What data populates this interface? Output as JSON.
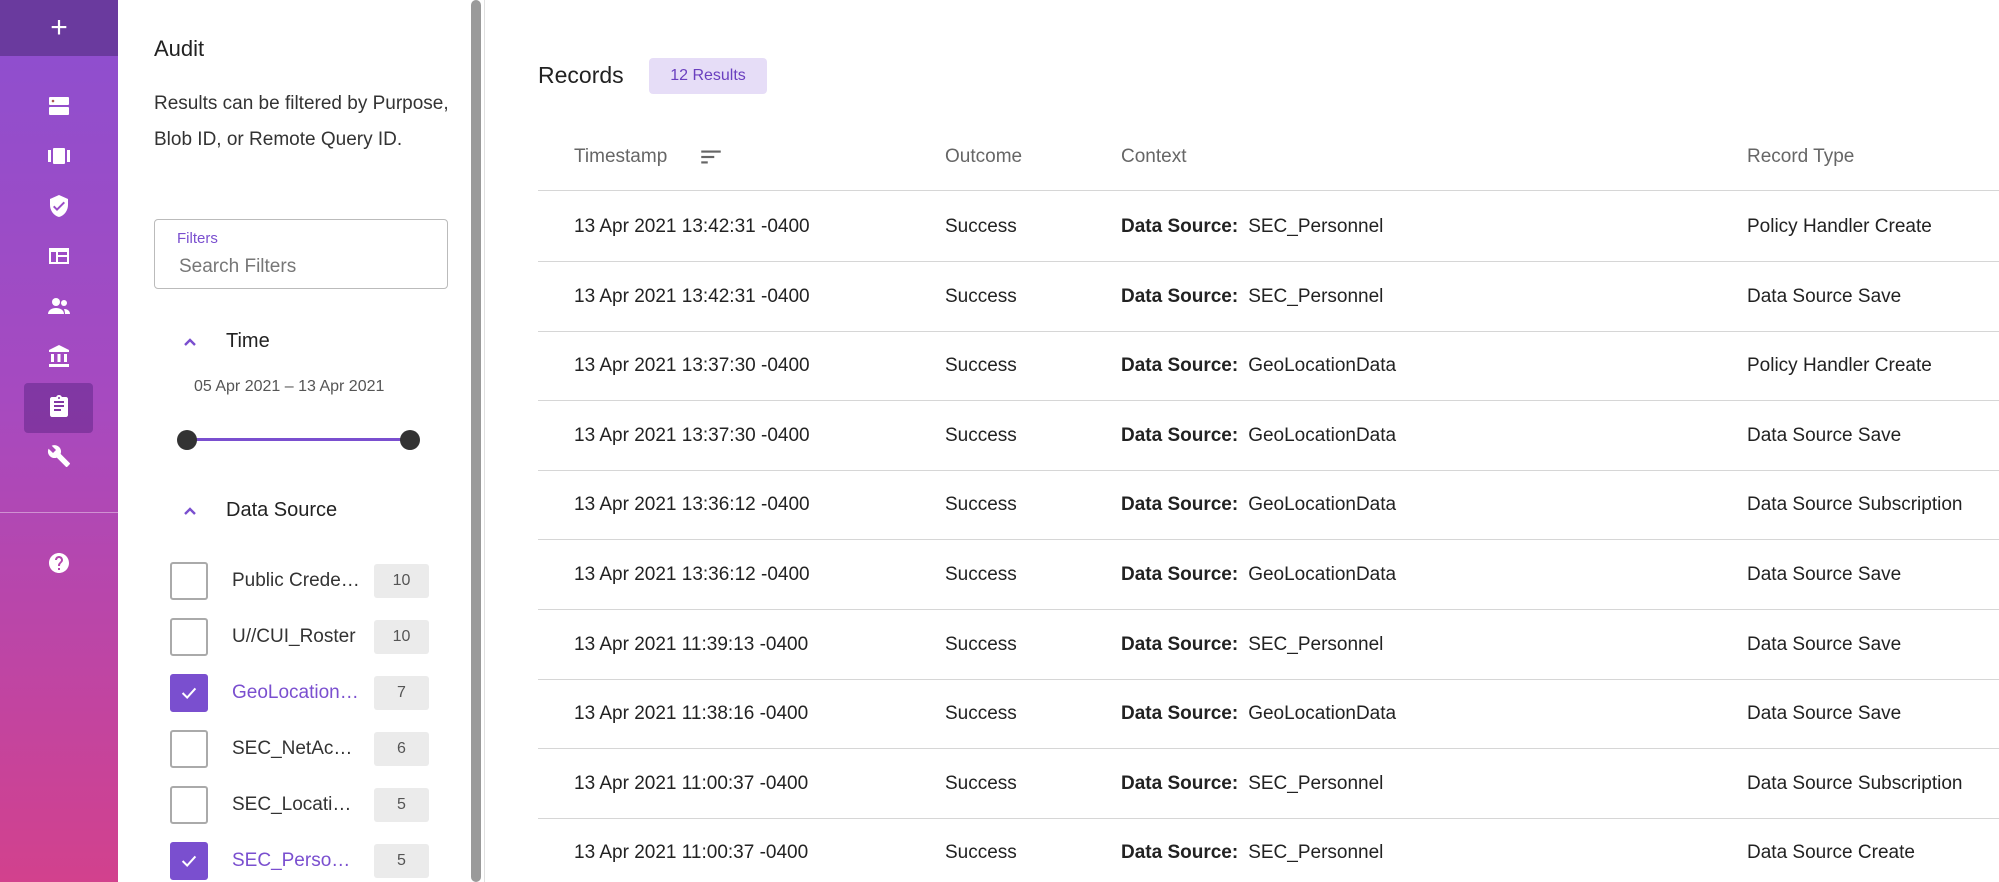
{
  "nav": {
    "add_label": "+",
    "items": [
      {
        "name": "servers-icon"
      },
      {
        "name": "cards-icon"
      },
      {
        "name": "shield-check-icon"
      },
      {
        "name": "table-icon"
      },
      {
        "name": "users-icon"
      },
      {
        "name": "bank-icon"
      },
      {
        "name": "clipboard-icon",
        "active": true
      },
      {
        "name": "wrench-icon"
      },
      {
        "name": "help-icon"
      }
    ]
  },
  "panel": {
    "title": "Audit",
    "description": "Results can be filtered by Purpose, Blob ID, or Remote Query ID.",
    "filters_label": "Filters",
    "search_placeholder": "Search Filters",
    "time_section": "Time",
    "time_range": "05 Apr 2021 – 13 Apr 2021",
    "data_source_section": "Data Source",
    "data_sources": [
      {
        "name": "Public Credentials",
        "count": "10",
        "checked": false
      },
      {
        "name": "U//CUI_Roster",
        "count": "10",
        "checked": false
      },
      {
        "name": "GeoLocationData",
        "count": "7",
        "checked": true
      },
      {
        "name": "SEC_NetAccess",
        "count": "6",
        "checked": false
      },
      {
        "name": "SEC_Locations",
        "count": "5",
        "checked": false
      },
      {
        "name": "SEC_Personnel",
        "count": "5",
        "checked": true
      }
    ]
  },
  "main": {
    "title": "Records",
    "results_badge": "12 Results",
    "columns": {
      "timestamp": "Timestamp",
      "outcome": "Outcome",
      "context": "Context",
      "record_type": "Record Type"
    },
    "context_prefix": "Data Source:",
    "rows": [
      {
        "timestamp": "13 Apr 2021 13:42:31 -0400",
        "outcome": "Success",
        "context": "SEC_Personnel",
        "record_type": "Policy Handler Create"
      },
      {
        "timestamp": "13 Apr 2021 13:42:31 -0400",
        "outcome": "Success",
        "context": "SEC_Personnel",
        "record_type": "Data Source Save"
      },
      {
        "timestamp": "13 Apr 2021 13:37:30 -0400",
        "outcome": "Success",
        "context": "GeoLocationData",
        "record_type": "Policy Handler Create"
      },
      {
        "timestamp": "13 Apr 2021 13:37:30 -0400",
        "outcome": "Success",
        "context": "GeoLocationData",
        "record_type": "Data Source Save"
      },
      {
        "timestamp": "13 Apr 2021 13:36:12 -0400",
        "outcome": "Success",
        "context": "GeoLocationData",
        "record_type": "Data Source Subscription"
      },
      {
        "timestamp": "13 Apr 2021 13:36:12 -0400",
        "outcome": "Success",
        "context": "GeoLocationData",
        "record_type": "Data Source Save"
      },
      {
        "timestamp": "13 Apr 2021 11:39:13 -0400",
        "outcome": "Success",
        "context": "SEC_Personnel",
        "record_type": "Data Source Save"
      },
      {
        "timestamp": "13 Apr 2021 11:38:16 -0400",
        "outcome": "Success",
        "context": "GeoLocationData",
        "record_type": "Data Source Save"
      },
      {
        "timestamp": "13 Apr 2021 11:00:37 -0400",
        "outcome": "Success",
        "context": "SEC_Personnel",
        "record_type": "Data Source Subscription"
      },
      {
        "timestamp": "13 Apr 2021 11:00:37 -0400",
        "outcome": "Success",
        "context": "SEC_Personnel",
        "record_type": "Data Source Create"
      }
    ]
  }
}
